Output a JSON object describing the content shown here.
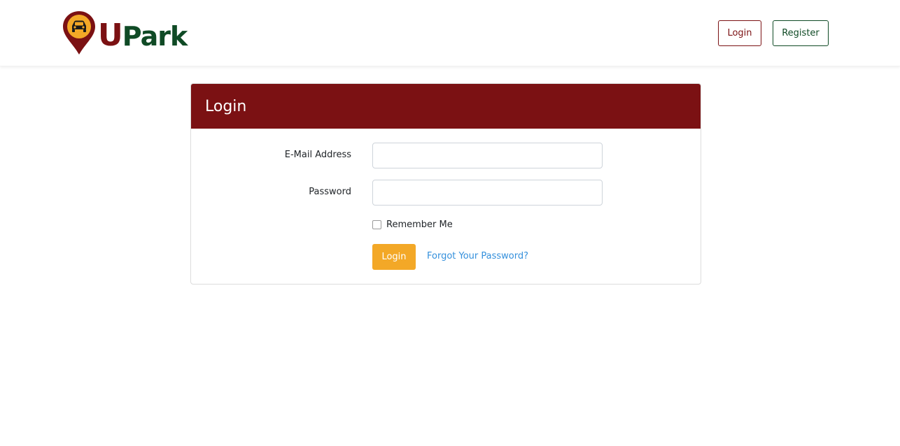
{
  "brand": {
    "name_first": "U",
    "name_rest": "Park",
    "colors": {
      "maroon": "#7b1113",
      "green": "#0f4a25",
      "yellow": "#f3a827"
    }
  },
  "nav": {
    "login_label": "Login",
    "register_label": "Register"
  },
  "login_form": {
    "title": "Login",
    "email_label": "E-Mail Address",
    "email_value": "",
    "password_label": "Password",
    "password_value": "",
    "remember_label": "Remember Me",
    "remember_checked": false,
    "submit_label": "Login",
    "forgot_label": "Forgot Your Password?"
  },
  "icons": {
    "logo": "map-pin-car-icon"
  }
}
